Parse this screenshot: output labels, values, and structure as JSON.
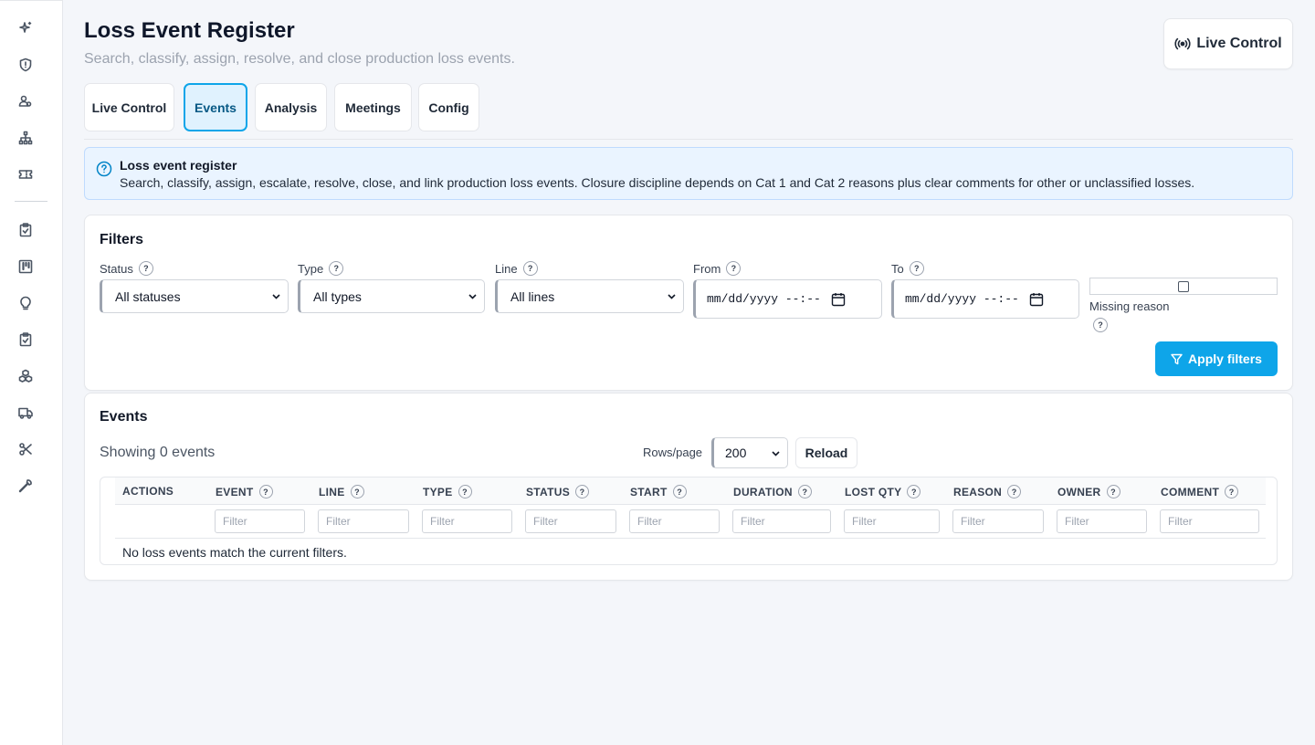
{
  "sidebar": {
    "icons": [
      "sparkles-icon",
      "shield-icon",
      "users-icon",
      "network-icon",
      "ticket-icon",
      "clipboard-icon",
      "kanban-icon",
      "lightbulb-icon",
      "clipboard-check-icon",
      "boxes-icon",
      "truck-icon",
      "scissors-icon",
      "wrench-icon"
    ]
  },
  "header": {
    "title": "Loss Event Register",
    "subtitle": "Search, classify, assign, resolve, and close production loss events.",
    "live_control_label": "Live Control"
  },
  "tabs": [
    {
      "label": "Live Control",
      "active": false
    },
    {
      "label": "Events",
      "active": true
    },
    {
      "label": "Analysis",
      "active": false
    },
    {
      "label": "Meetings",
      "active": false
    },
    {
      "label": "Config",
      "active": false
    }
  ],
  "info": {
    "title": "Loss event register",
    "text": "Search, classify, assign, escalate, resolve, close, and link production loss events. Closure discipline depends on Cat 1 and Cat 2 reasons plus clear comments for other or unclassified losses."
  },
  "filters": {
    "title": "Filters",
    "status": {
      "label": "Status",
      "value": "All statuses"
    },
    "type": {
      "label": "Type",
      "value": "All types"
    },
    "line": {
      "label": "Line",
      "value": "All lines"
    },
    "from": {
      "label": "From",
      "value": "mm/dd/yyyy --:--"
    },
    "to": {
      "label": "To",
      "value": "mm/dd/yyyy --:--"
    },
    "missing_reason_label": "Missing reason",
    "apply_label": "Apply filters",
    "help": "?"
  },
  "events": {
    "title": "Events",
    "showing": "Showing 0 events",
    "rows_per_page_label": "Rows/page",
    "rows_per_page_value": "200",
    "reload_label": "Reload",
    "columns": [
      "ACTIONS",
      "EVENT",
      "LINE",
      "TYPE",
      "STATUS",
      "START",
      "DURATION",
      "LOST QTY",
      "REASON",
      "OWNER",
      "COMMENT"
    ],
    "filter_placeholder": "Filter",
    "empty_message": "No loss events match the current filters."
  },
  "colors": {
    "accent": "#0ea5e9",
    "active_tab_bg": "#e0f2fe",
    "info_bg": "#eaf4ff"
  }
}
